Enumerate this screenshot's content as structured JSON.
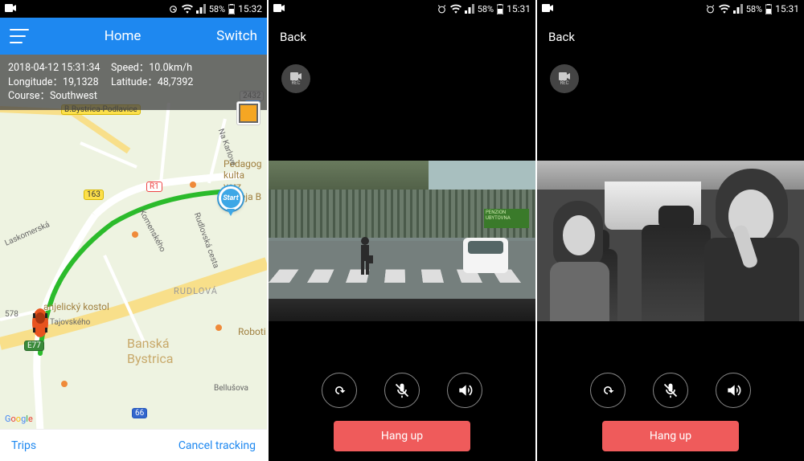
{
  "status1": {
    "time": "15:32",
    "battery": "58%"
  },
  "status2": {
    "time": "15:31",
    "battery": "58%"
  },
  "status3": {
    "time": "15:31",
    "battery": "58%"
  },
  "s1": {
    "header": {
      "title": "Home",
      "switch": "Switch"
    },
    "info": {
      "datetime": "2018-04-12 15:31:34",
      "speed_lbl": "Speed：",
      "speed": "10.0km/h",
      "lng_lbl": "Longitude：",
      "lng": "19,1328",
      "lat_lbl": "Latitude：",
      "lat": "48,7392",
      "course_lbl": "Course：",
      "course": "Southwest"
    },
    "start_label": "Start",
    "map": {
      "city": "Banská\nBystrica",
      "district1": "RUDLOVÁ",
      "suburb": "B.Bystrica-Podlavice",
      "poi_kostol": "anjelický kostol",
      "poi_pedag": "Pedagog\nkulta\nverz\nMateja B",
      "poi_robot": "Roboti",
      "street_tajov": "Tajovského",
      "street_lasko": "Laskomerská",
      "street_karlov": "Na Karlove",
      "street_komen": "Komenského",
      "street_rudlov": "Rudlovská cesta",
      "street_bellus": "Bellušova",
      "r163": "163",
      "rR1": "R1",
      "rE77": "E77",
      "r578": "578",
      "r66": "66",
      "r2432": "2432",
      "google": "Google"
    },
    "bottom": {
      "trips": "Trips",
      "cancel": "Cancel tracking"
    }
  },
  "cam": {
    "back": "Back",
    "rec": "REC",
    "hangup": "Hang up"
  },
  "s2": {
    "sign": "PENZION UBYTOVNA"
  }
}
